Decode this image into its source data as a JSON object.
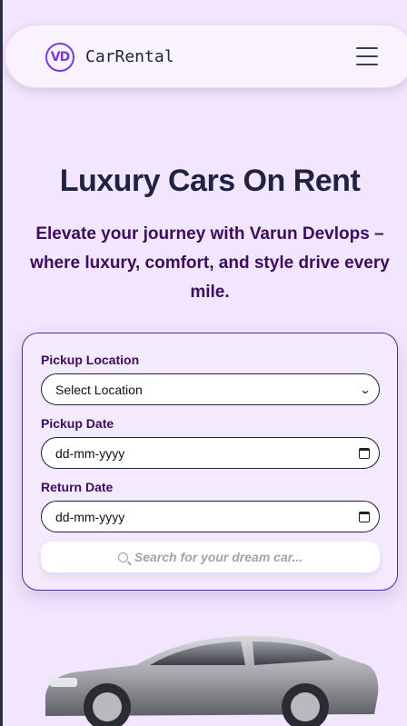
{
  "navbar": {
    "logo_text": "VD",
    "brand": "CarRental",
    "menu_icon": "hamburger-icon"
  },
  "hero": {
    "title": "Luxury Cars On Rent",
    "subtitle": "Elevate your journey with Varun Devlops – where luxury, comfort, and style drive every mile."
  },
  "search_form": {
    "pickup_location": {
      "label": "Pickup Location",
      "value": "Select Location"
    },
    "pickup_date": {
      "label": "Pickup Date",
      "value": "dd-mm-yyyy"
    },
    "return_date": {
      "label": "Return Date",
      "value": "dd-mm-yyyy"
    },
    "search": {
      "placeholder": "Search for your dream car..."
    }
  },
  "colors": {
    "background": "#f1e6fd",
    "accent": "#7a3ce0",
    "heading": "#1f2240",
    "subheading": "#3d0c5c"
  }
}
